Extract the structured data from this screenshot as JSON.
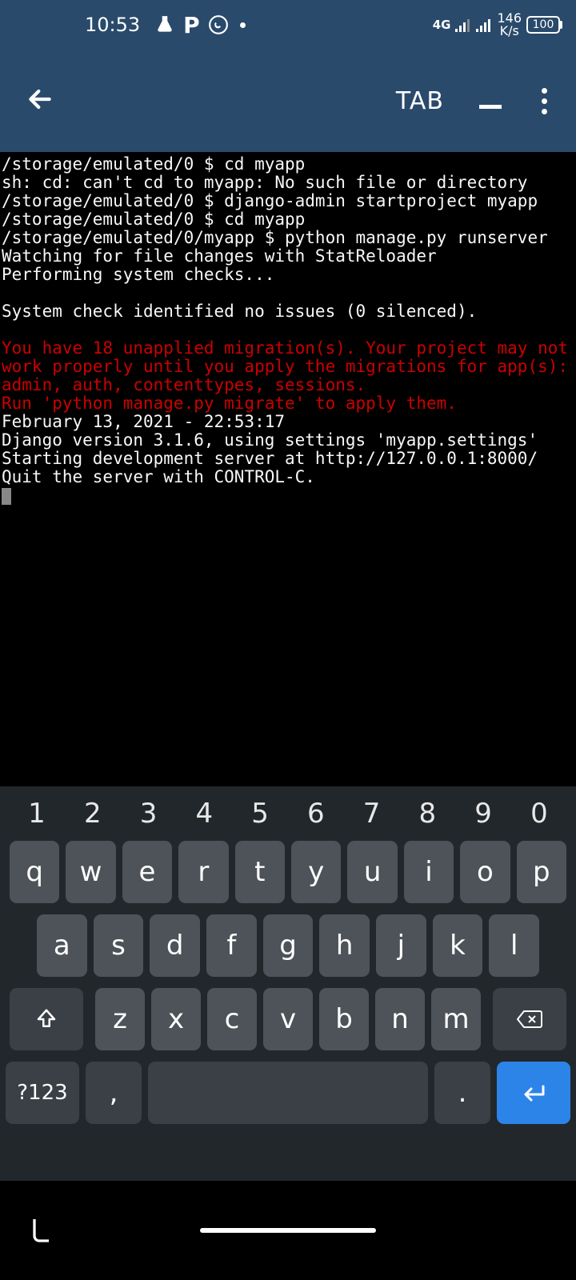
{
  "status_bar": {
    "time": "10:53",
    "network_type": "4G",
    "net_speed_top": "146",
    "net_speed_bottom": "K/s",
    "battery": "100"
  },
  "header": {
    "tab_label": "TAB"
  },
  "terminal": {
    "lines": [
      "/storage/emulated/0 $ cd myapp",
      "sh: cd: can't cd to myapp: No such file or directory",
      "/storage/emulated/0 $ django-admin startproject myapp",
      "/storage/emulated/0 $ cd myapp",
      "/storage/emulated/0/myapp $ python manage.py runserver",
      "Watching for file changes with StatReloader",
      "Performing system checks...",
      "",
      "System check identified no issues (0 silenced).",
      ""
    ],
    "warning": [
      "You have 18 unapplied migration(s). Your project may not work properly until you apply the migrations for app(s): admin, auth, contenttypes, sessions.",
      "Run 'python manage.py migrate' to apply them."
    ],
    "tail": [
      "February 13, 2021 - 22:53:17",
      "Django version 3.1.6, using settings 'myapp.settings'",
      "Starting development server at http://127.0.0.1:8000/",
      "Quit the server with CONTROL-C."
    ]
  },
  "keyboard": {
    "numbers": [
      "1",
      "2",
      "3",
      "4",
      "5",
      "6",
      "7",
      "8",
      "9",
      "0"
    ],
    "row1": [
      "q",
      "w",
      "e",
      "r",
      "t",
      "y",
      "u",
      "i",
      "o",
      "p"
    ],
    "row2": [
      "a",
      "s",
      "d",
      "f",
      "g",
      "h",
      "j",
      "k",
      "l"
    ],
    "row3": [
      "z",
      "x",
      "c",
      "v",
      "b",
      "n",
      "m"
    ],
    "symbols_label": "?123",
    "comma": ",",
    "period": "."
  }
}
